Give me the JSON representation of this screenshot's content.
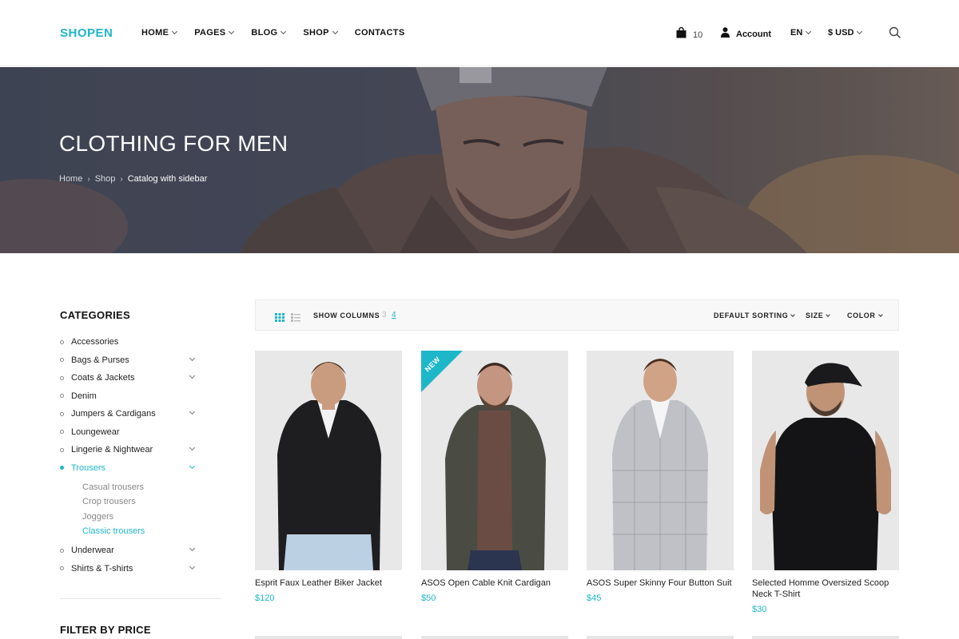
{
  "header": {
    "logo": "SHOPEN",
    "nav": [
      "HOME",
      "PAGES",
      "BLOG",
      "SHOP",
      "CONTACTS"
    ],
    "cart_count": "10",
    "account_label": "Account",
    "language": "EN",
    "currency": "$ USD"
  },
  "hero": {
    "title": "CLOTHING FOR MEN",
    "breadcrumb": [
      "Home",
      "Shop",
      "Catalog with sidebar"
    ]
  },
  "sidebar": {
    "categories_title": "CATEGORIES",
    "categories": [
      {
        "label": "Accessories"
      },
      {
        "label": "Bags & Purses"
      },
      {
        "label": "Coats & Jackets"
      },
      {
        "label": "Denim"
      },
      {
        "label": "Jumpers & Cardigans"
      },
      {
        "label": "Loungewear"
      },
      {
        "label": "Lingerie & Nightwear"
      },
      {
        "label": "Trousers"
      },
      {
        "label": "Underwear"
      },
      {
        "label": "Shirts & T-shirts"
      }
    ],
    "trousers_sub": [
      "Casual trousers",
      "Crop trousers",
      "Joggers",
      "Classic trousers"
    ],
    "filter_title": "FILTER BY PRICE"
  },
  "toolbar": {
    "show_columns": "SHOW COLUMNS",
    "col_3": "3",
    "col_4": "4",
    "sorting": "DEFAULT SORTING",
    "size": "SIZE",
    "color": "COLOR"
  },
  "products": [
    {
      "name": "Esprit Faux Leather Biker Jacket",
      "price": "$120"
    },
    {
      "name": "ASOS Open Cable Knit Cardigan",
      "price": "$50",
      "badge": "NEW"
    },
    {
      "name": "ASOS Super Skinny Four Button Suit",
      "price": "$45"
    },
    {
      "name": "Selected Homme Oversized Scoop Neck T-Shirt",
      "price": "$30"
    }
  ],
  "colors": {
    "accent": "#1eb6c9"
  }
}
